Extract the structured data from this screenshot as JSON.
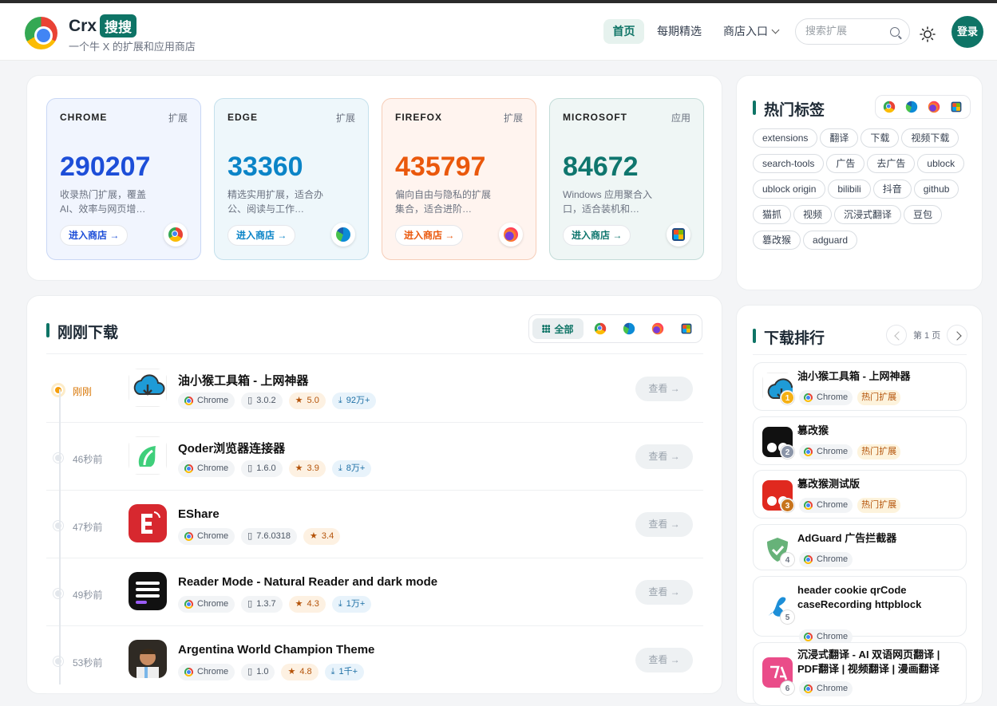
{
  "header": {
    "brand_name": "Crx",
    "brand_badge": "搜搜",
    "tagline": "一个牛 X 的扩展和应用商店",
    "nav": {
      "home": "首页",
      "weekly": "每期精选",
      "stores": "商店入口"
    },
    "search_placeholder": "搜索扩展",
    "login": "登录"
  },
  "stores": [
    {
      "name": "CHROME",
      "type": "扩展",
      "count": "290207",
      "desc": "收录热门扩展，覆盖 AI、效率与网页增…",
      "btn": "进入商店 →",
      "color": "#1d4ed8",
      "bg": "#f1f5fe",
      "border": "#c9d7f5",
      "icon": "chrome-icon"
    },
    {
      "name": "EDGE",
      "type": "扩展",
      "count": "33360",
      "desc": "精选实用扩展，适合办公、阅读与工作…",
      "btn": "进入商店 →",
      "color": "#0b84c7",
      "bg": "#eef7fb",
      "border": "#c4e0ec",
      "icon": "edge-icon"
    },
    {
      "name": "FIREFOX",
      "type": "扩展",
      "count": "435797",
      "desc": "偏向自由与隐私的扩展集合，适合进阶…",
      "btn": "进入商店 →",
      "color": "#ea580c",
      "bg": "#fff4ef",
      "border": "#f6cdb8",
      "icon": "firefox-icon"
    },
    {
      "name": "MICROSOFT",
      "type": "应用",
      "count": "84672",
      "desc": "Windows 应用聚合入口，适合装机和…",
      "btn": "进入商店 →",
      "color": "#0f766e",
      "bg": "#eff6f5",
      "border": "#c3dcd8",
      "icon": "microsoft-store-icon"
    }
  ],
  "recent": {
    "title": "刚刚下载",
    "filter_all": "全部",
    "view_label": "查看 →",
    "items": [
      {
        "time": "刚刚",
        "name": "油小猴工具箱 - 上网神器",
        "browser": "Chrome",
        "version": "3.0.2",
        "rating": "5.0",
        "downloads": "92万+"
      },
      {
        "time": "46秒前",
        "name": "Qoder浏览器连接器",
        "browser": "Chrome",
        "version": "1.6.0",
        "rating": "3.9",
        "downloads": "8万+"
      },
      {
        "time": "47秒前",
        "name": "EShare",
        "browser": "Chrome",
        "version": "7.6.0318",
        "rating": "3.4",
        "downloads": ""
      },
      {
        "time": "49秒前",
        "name": "Reader Mode - Natural Reader and dark mode",
        "browser": "Chrome",
        "version": "1.3.7",
        "rating": "4.3",
        "downloads": "1万+"
      },
      {
        "time": "53秒前",
        "name": "Argentina World Champion Theme",
        "browser": "Chrome",
        "version": "1.0",
        "rating": "4.8",
        "downloads": "1千+"
      }
    ]
  },
  "hot_tags": {
    "title": "热门标签",
    "tags": [
      "extensions",
      "翻译",
      "下载",
      "视频下载",
      "search-tools",
      "广告",
      "去广告",
      "ublock",
      "ublock origin",
      "bilibili",
      "抖音",
      "github",
      "猫抓",
      "视频",
      "沉浸式翻译",
      "豆包",
      "篡改猴",
      "adguard"
    ]
  },
  "ranking": {
    "title": "下载排行",
    "page": "第 1 页",
    "items": [
      {
        "rank": "1",
        "name": "油小猴工具箱 - 上网神器",
        "browser": "Chrome",
        "badge": "热门扩展"
      },
      {
        "rank": "2",
        "name": "篡改猴",
        "browser": "Chrome",
        "badge": "热门扩展"
      },
      {
        "rank": "3",
        "name": "篡改猴测试版",
        "browser": "Chrome",
        "badge": "热门扩展"
      },
      {
        "rank": "4",
        "name": "AdGuard 广告拦截器",
        "browser": "Chrome",
        "badge": ""
      },
      {
        "rank": "5",
        "name": "header cookie qrCode caseRecording httpblock",
        "browser": "Chrome",
        "badge": ""
      },
      {
        "rank": "6",
        "name": "沉浸式翻译 - AI 双语网页翻译 | PDF翻译 | 视频翻译 | 漫画翻译",
        "browser": "Chrome",
        "badge": ""
      }
    ]
  }
}
